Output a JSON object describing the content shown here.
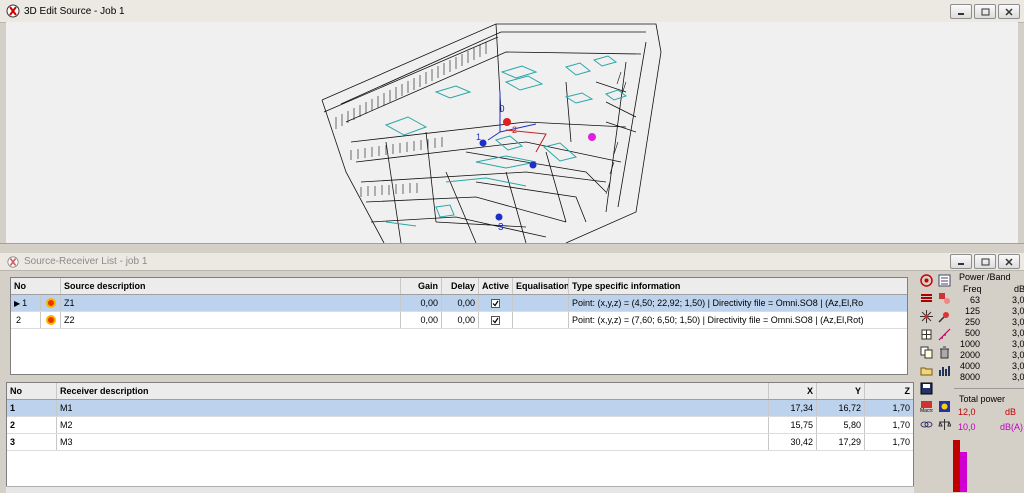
{
  "top_window": {
    "title": "3D Edit Source - Job 1"
  },
  "viewport": {
    "labels": [
      "0",
      "1",
      "2",
      "3"
    ],
    "colors": {
      "source": "#e02020",
      "receiver": "#1c2fc8",
      "magenta": "#e020e0",
      "cyan": "#2aa6a6",
      "line": "#111111"
    }
  },
  "bottom_window": {
    "title": "Source-Receiver List - job 1"
  },
  "sources": {
    "headers": [
      "No",
      "Source description",
      "Gain",
      "Delay",
      "Active",
      "Equalisation",
      "Type specific information"
    ],
    "rows": [
      {
        "no": "1",
        "desc": "Z1",
        "gain": "0,00",
        "delay": "0,00",
        "active": true,
        "eq": "",
        "info": "Point:  (x,y,z) = (4,50; 22,92; 1,50)  |  Directivity file = Omni.SO8  |  (Az,El,Ro"
      },
      {
        "no": "2",
        "desc": "Z2",
        "gain": "0,00",
        "delay": "0,00",
        "active": true,
        "eq": "",
        "info": "Point:  (x,y,z) = (7,60; 6,50; 1,50)  |  Directivity file = Omni.SO8  |  (Az,El,Rot)"
      }
    ]
  },
  "receivers": {
    "headers": [
      "No",
      "Receiver description",
      "X",
      "Y",
      "Z"
    ],
    "rows": [
      {
        "no": "1",
        "desc": "M1",
        "x": "17,34",
        "y": "16,72",
        "z": "1,70"
      },
      {
        "no": "2",
        "desc": "M2",
        "x": "15,75",
        "y": "5,80",
        "z": "1,70"
      },
      {
        "no": "3",
        "desc": "M3",
        "x": "30,42",
        "y": "17,29",
        "z": "1,70"
      }
    ]
  },
  "power_panel": {
    "title": "Power /Band",
    "freq_header": "Freq",
    "db_header": "dB",
    "bands": [
      {
        "freq": "63",
        "db": "3,0"
      },
      {
        "freq": "125",
        "db": "3,0"
      },
      {
        "freq": "250",
        "db": "3,0"
      },
      {
        "freq": "500",
        "db": "3,0"
      },
      {
        "freq": "1000",
        "db": "3,0"
      },
      {
        "freq": "2000",
        "db": "3,0"
      },
      {
        "freq": "4000",
        "db": "3,0"
      },
      {
        "freq": "8000",
        "db": "3,0"
      }
    ],
    "total_title": "Total power",
    "total_db": "12,0",
    "total_db_unit": "dB",
    "total_dba": "10,0",
    "total_dba_unit": "dB(A)",
    "colors": {
      "db": "#c00000",
      "dba": "#c000c0"
    }
  }
}
